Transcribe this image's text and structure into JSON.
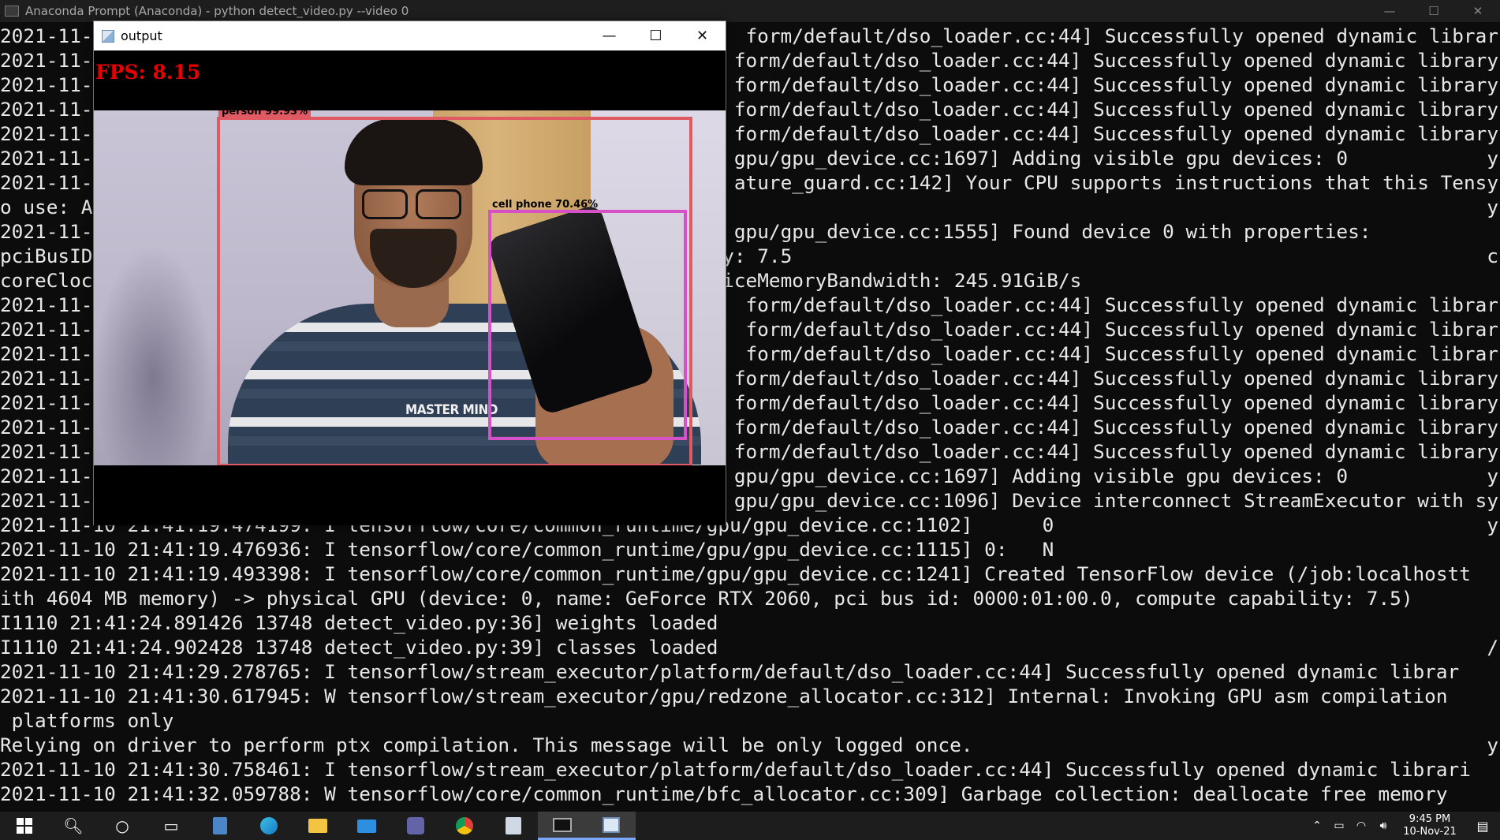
{
  "console": {
    "title": "Anaconda Prompt (Anaconda) - python  detect_video.py --video 0",
    "lines": [
      {
        "left": "2021-11-",
        "right": "form/default/dso_loader.cc:44] Successfully opened dynamic librar"
      },
      {
        "left": "2021-11-",
        "right": "form/default/dso_loader.cc:44] Successfully opened dynamic library"
      },
      {
        "left": "2021-11-",
        "right": "form/default/dso_loader.cc:44] Successfully opened dynamic library"
      },
      {
        "left": "2021-11-",
        "right": "form/default/dso_loader.cc:44] Successfully opened dynamic library"
      },
      {
        "left": "2021-11-",
        "right": "form/default/dso_loader.cc:44] Successfully opened dynamic library"
      },
      {
        "left": "2021-11-",
        "right": "gpu/gpu_device.cc:1697] Adding visible gpu devices: 0            y"
      },
      {
        "left": "2021-11-",
        "right": "ature_guard.cc:142] Your CPU supports instructions that this Tensy"
      },
      {
        "left": "o use: A",
        "right": "y"
      },
      {
        "left": "2021-11-",
        "right": "gpu/gpu_device.cc:1555] Found device 0 with properties:           "
      },
      {
        "left": "pciBusID",
        "right": "y: 7.5                                                            c"
      },
      {
        "left": "coreCloc",
        "right": "iceMemoryBandwidth: 245.91GiB/s                                    "
      },
      {
        "left": "2021-11-",
        "right": "form/default/dso_loader.cc:44] Successfully opened dynamic librar"
      },
      {
        "left": "2021-11-",
        "right": "form/default/dso_loader.cc:44] Successfully opened dynamic librar"
      },
      {
        "left": "2021-11-",
        "right": "form/default/dso_loader.cc:44] Successfully opened dynamic librar"
      },
      {
        "left": "2021-11-",
        "right": "form/default/dso_loader.cc:44] Successfully opened dynamic library"
      },
      {
        "left": "2021-11-",
        "right": "form/default/dso_loader.cc:44] Successfully opened dynamic library"
      },
      {
        "left": "2021-11-",
        "right": "form/default/dso_loader.cc:44] Successfully opened dynamic library"
      },
      {
        "left": "2021-11-",
        "right": "form/default/dso_loader.cc:44] Successfully opened dynamic library"
      },
      {
        "left": "2021-11-",
        "right": "gpu/gpu_device.cc:1697] Adding visible gpu devices: 0            y"
      },
      {
        "left": "2021-11-",
        "right": "gpu/gpu_device.cc:1096] Device interconnect StreamExecutor with sy"
      },
      {
        "left": "2021-11-10 21:41:19.474199: I tensorflow/core/common_runtime/gpu/gpu_device.cc:1102]      0",
        "right": "y"
      },
      {
        "left": "2021-11-10 21:41:19.476936: I tensorflow/core/common_runtime/gpu/gpu_device.cc:1115] 0:   N",
        "right": ""
      },
      {
        "left": "2021-11-10 21:41:19.493398: I tensorflow/core/common_runtime/gpu/gpu_device.cc:1241] Created TensorFlow device (/job:localhostt",
        "right": ""
      },
      {
        "left": "ith 4604 MB memory) -> physical GPU (device: 0, name: GeForce RTX 2060, pci bus id: 0000:01:00.0, compute capability: 7.5)",
        "right": ""
      },
      {
        "left": "I1110 21:41:24.891426 13748 detect_video.py:36] weights loaded",
        "right": ""
      },
      {
        "left": "I1110 21:41:24.902428 13748 detect_video.py:39] classes loaded",
        "right": "/"
      },
      {
        "left": "2021-11-10 21:41:29.278765: I tensorflow/stream_executor/platform/default/dso_loader.cc:44] Successfully opened dynamic librar",
        "right": ""
      },
      {
        "left": "2021-11-10 21:41:30.617945: W tensorflow/stream_executor/gpu/redzone_allocator.cc:312] Internal: Invoking GPU asm compilation",
        "right": ""
      },
      {
        "left": " platforms only",
        "right": ""
      },
      {
        "left": "Relying on driver to perform ptx compilation. This message will be only logged once.",
        "right": "y"
      },
      {
        "left": "2021-11-10 21:41:30.758461: I tensorflow/stream_executor/platform/default/dso_loader.cc:44] Successfully opened dynamic librari",
        "right": ""
      },
      {
        "left": "2021-11-10 21:41:32.059788: W tensorflow/core/common_runtime/bfc_allocator.cc:309] Garbage collection: deallocate free memory",
        "right": ""
      }
    ]
  },
  "output_window": {
    "title": "output",
    "fps_label": "FPS: 8.15",
    "detections": [
      {
        "label": "person 99.93%",
        "color": "#e05a63"
      },
      {
        "label": "cell phone 70.46%",
        "color": "#d651c8"
      }
    ],
    "shirt_text": "MASTER MIND"
  },
  "window_controls": {
    "minimize": "—",
    "maximize": "☐",
    "close": "✕"
  },
  "taskbar": {
    "items": [
      "start-icon",
      "search-icon",
      "cortana-icon",
      "task-view-icon",
      "calculator-icon",
      "edge-icon",
      "file-explorer-icon",
      "mail-icon",
      "teams-icon",
      "chrome-icon",
      "files-icon",
      "terminal-icon",
      "output-window-icon"
    ],
    "time": "9:45 PM",
    "date": "10-Nov-21"
  }
}
